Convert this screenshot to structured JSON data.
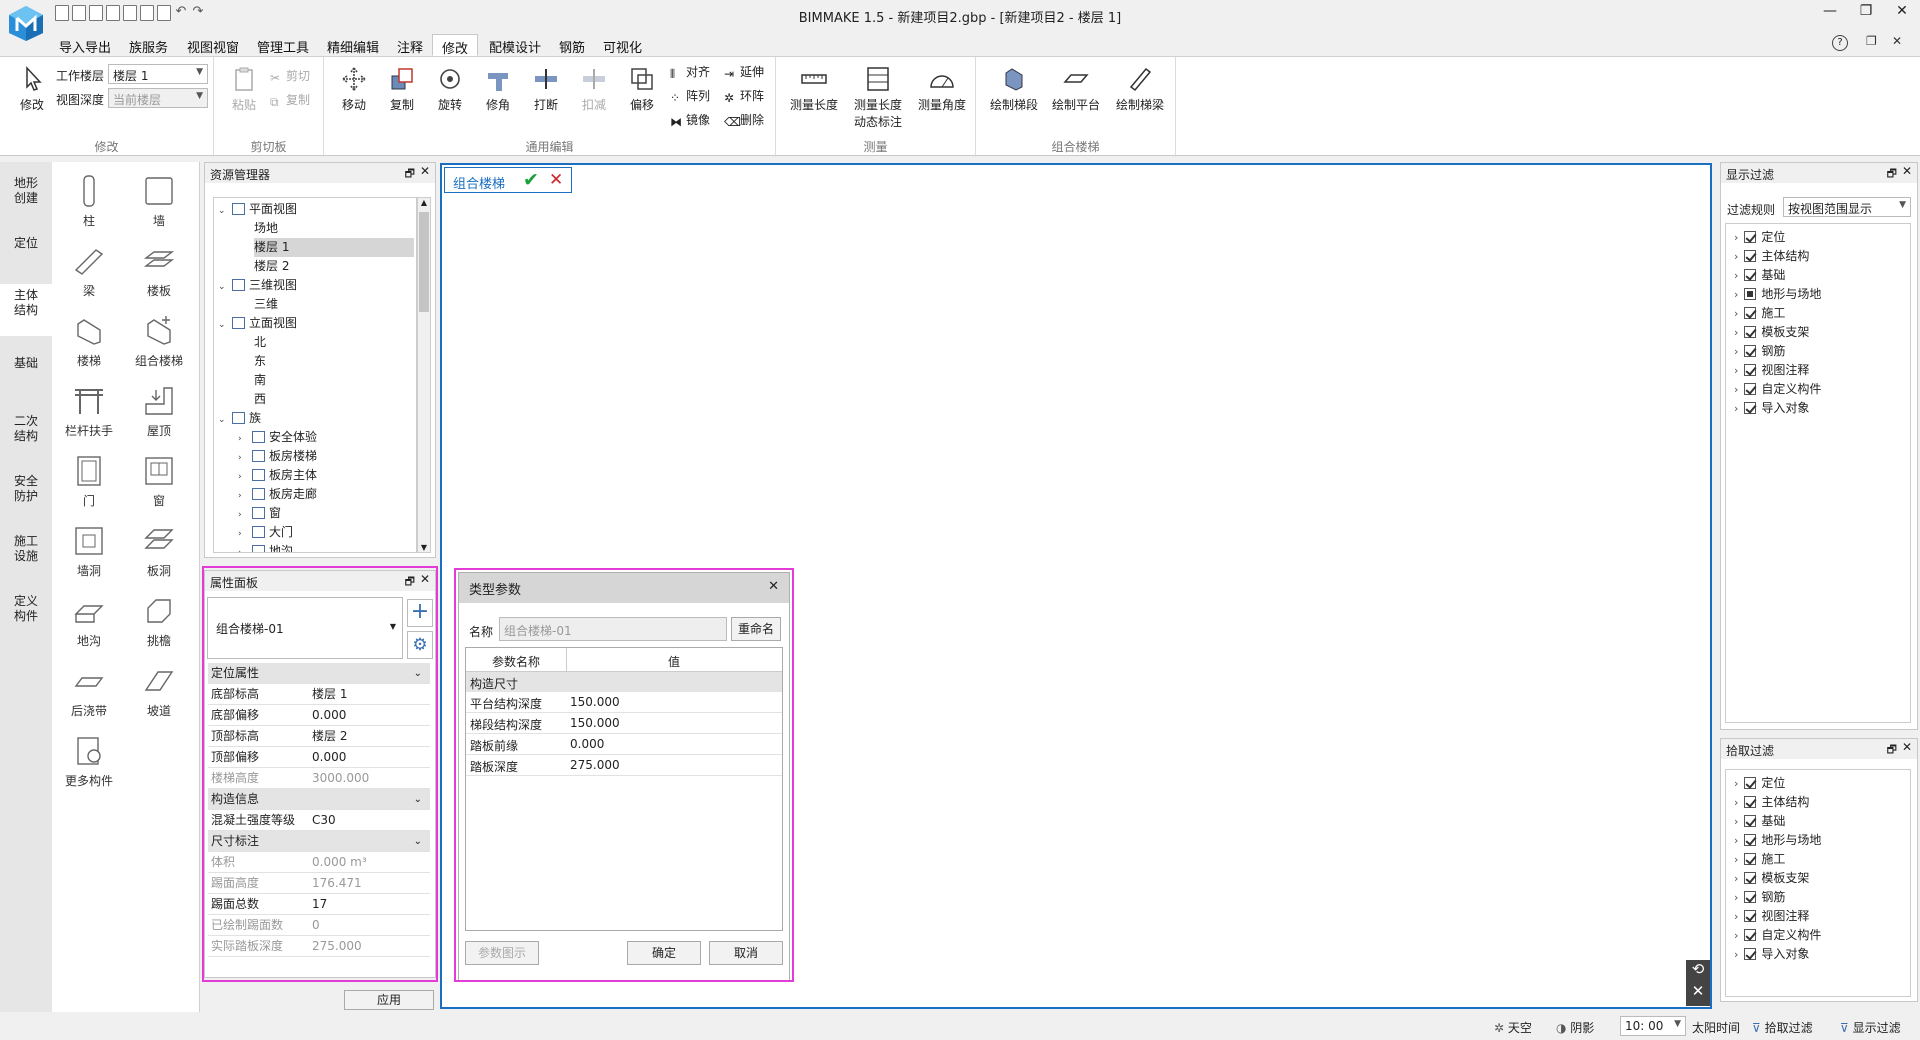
{
  "window": {
    "title": "BIMMAKE 1.5 - 新建项目2.gbp - [新建项目2 - 楼层 1]",
    "minimize": "—",
    "restore": "❐",
    "close": "✕"
  },
  "menu": {
    "tabs": [
      "导入导出",
      "族服务",
      "视图视窗",
      "管理工具",
      "精细编辑",
      "注释",
      "修改",
      "配模设计",
      "钢筋",
      "可视化"
    ],
    "active_index": 6,
    "help": "?",
    "ribbon_restore": "❐",
    "ribbon_close": "✕"
  },
  "ribbon": {
    "modify_group": {
      "label": "修改",
      "modify_btn": "修改",
      "work_floor_label": "工作楼层",
      "work_floor_value": "楼层 1",
      "view_depth_label": "视图深度",
      "view_depth_value": "当前楼层"
    },
    "clipboard_group": {
      "label": "剪切板",
      "paste": "粘贴",
      "cut": "剪切",
      "copy": "复制"
    },
    "edit_group": {
      "label": "通用编辑",
      "move": "移动",
      "copy": "复制",
      "rotate": "旋转",
      "corner": "修角",
      "break": "打断",
      "trim": "扣减",
      "offset": "偏移",
      "align": "对齐",
      "array": "阵列",
      "mirror": "镜像",
      "extend": "延伸",
      "ring_array": "环阵",
      "delete": "删除"
    },
    "measure_group": {
      "label": "测量",
      "length": "测量长度",
      "length_dim_1": "测量长度",
      "length_dim_2": "动态标注",
      "angle": "测量角度"
    },
    "stairs_group": {
      "label": "组合楼梯",
      "draw_flight": "绘制梯段",
      "draw_platform": "绘制平台",
      "draw_beam": "绘制梯梁"
    }
  },
  "categories": [
    "地形\n创建",
    "定位",
    "主体\n结构",
    "基础",
    "二次\n结构",
    "安全\n防护",
    "施工\n设施",
    "定义\n构件"
  ],
  "active_category": 2,
  "palette": [
    "柱",
    "墙",
    "梁",
    "楼板",
    "楼梯",
    "组合楼梯",
    "栏杆扶手",
    "屋顶",
    "门",
    "窗",
    "墙洞",
    "板洞",
    "地沟",
    "挑檐",
    "后浇带",
    "坡道",
    "更多构件"
  ],
  "resource_manager": {
    "title": "资源管理器",
    "pin": "🗗",
    "close": "✕",
    "tree": [
      {
        "label": "平面视图",
        "level": 0,
        "twist": "v",
        "icon": true
      },
      {
        "label": "场地",
        "level": 1
      },
      {
        "label": "楼层 1",
        "level": 1,
        "selected": true
      },
      {
        "label": "楼层 2",
        "level": 1
      },
      {
        "label": "三维视图",
        "level": 0,
        "twist": "v",
        "icon": true
      },
      {
        "label": "三维",
        "level": 1
      },
      {
        "label": "立面视图",
        "level": 0,
        "twist": "v",
        "icon": true
      },
      {
        "label": "北",
        "level": 1
      },
      {
        "label": "东",
        "level": 1
      },
      {
        "label": "南",
        "level": 1
      },
      {
        "label": "西",
        "level": 1
      },
      {
        "label": "族",
        "level": 0,
        "twist": "v",
        "icon": true
      },
      {
        "label": "安全体验",
        "level": 1,
        "twist": ">",
        "icon": true
      },
      {
        "label": "板房楼梯",
        "level": 1,
        "twist": ">",
        "icon": true
      },
      {
        "label": "板房主体",
        "level": 1,
        "twist": ">",
        "icon": true
      },
      {
        "label": "板房走廊",
        "level": 1,
        "twist": ">",
        "icon": true
      },
      {
        "label": "窗",
        "level": 1,
        "twist": ">",
        "icon": true
      },
      {
        "label": "大门",
        "level": 1,
        "twist": ">",
        "icon": true
      },
      {
        "label": "地沟",
        "level": 1,
        "twist": ">",
        "icon": true
      }
    ]
  },
  "properties": {
    "title": "属性面板",
    "pin": "🗗",
    "close": "✕",
    "type_name": "组合楼梯-01",
    "add_icon": "+",
    "settings_icon": "⚙",
    "rows": [
      {
        "key": "定位属性",
        "section": true
      },
      {
        "key": "底部标高",
        "value": "楼层 1"
      },
      {
        "key": "底部偏移",
        "value": "0.000"
      },
      {
        "key": "顶部标高",
        "value": "楼层 2"
      },
      {
        "key": "顶部偏移",
        "value": "0.000"
      },
      {
        "key": "楼梯高度",
        "value": "3000.000",
        "dim": true
      },
      {
        "key": "构造信息",
        "section": true
      },
      {
        "key": "混凝土强度等级",
        "value": "C30"
      },
      {
        "key": "尺寸标注",
        "section": true
      },
      {
        "key": "体积",
        "value": "0.000 m³",
        "dim": true
      },
      {
        "key": "踢面高度",
        "value": "176.471",
        "dim": true
      },
      {
        "key": "踢面总数",
        "value": "17"
      },
      {
        "key": "已绘制踢面数",
        "value": "0",
        "dim": true
      },
      {
        "key": "实际踏板深度",
        "value": "275.000",
        "dim": true
      }
    ],
    "apply": "应用"
  },
  "canvas": {
    "tab_label": "组合楼梯",
    "confirm": "✔",
    "cancel": "✕",
    "reset_icon": "⟲",
    "close_icon": "✕"
  },
  "type_params_dialog": {
    "title": "类型参数",
    "close": "✕",
    "name_label": "名称",
    "name_value": "组合楼梯-01",
    "rename": "重命名",
    "col_param": "参数名称",
    "col_value": "值",
    "section": "构造尺寸",
    "rows": [
      {
        "param": "平台结构深度",
        "value": "150.000"
      },
      {
        "param": "梯段结构深度",
        "value": "150.000"
      },
      {
        "param": "踏板前缘",
        "value": "0.000"
      },
      {
        "param": "踏板深度",
        "value": "275.000"
      }
    ],
    "param_diagram": "参数图示",
    "ok": "确定",
    "cancel": "取消"
  },
  "display_filter": {
    "title": "显示过滤",
    "pin": "🗗",
    "close": "✕",
    "rule_label": "过滤规则",
    "rule_value": "按视图范围显示",
    "items": [
      {
        "label": "定位",
        "state": "on"
      },
      {
        "label": "主体结构",
        "state": "on"
      },
      {
        "label": "基础",
        "state": "on"
      },
      {
        "label": "地形与场地",
        "state": "part"
      },
      {
        "label": "施工",
        "state": "on"
      },
      {
        "label": "模板支架",
        "state": "on"
      },
      {
        "label": "钢筋",
        "state": "on"
      },
      {
        "label": "视图注释",
        "state": "on"
      },
      {
        "label": "自定义构件",
        "state": "on"
      },
      {
        "label": "导入对象",
        "state": "on"
      }
    ]
  },
  "pick_filter": {
    "title": "拾取过滤",
    "pin": "🗗",
    "close": "✕",
    "items": [
      {
        "label": "定位",
        "state": "on"
      },
      {
        "label": "主体结构",
        "state": "on"
      },
      {
        "label": "基础",
        "state": "on"
      },
      {
        "label": "地形与场地",
        "state": "on"
      },
      {
        "label": "施工",
        "state": "on"
      },
      {
        "label": "模板支架",
        "state": "on"
      },
      {
        "label": "钢筋",
        "state": "on"
      },
      {
        "label": "视图注释",
        "state": "on"
      },
      {
        "label": "自定义构件",
        "state": "on"
      },
      {
        "label": "导入对象",
        "state": "on"
      }
    ]
  },
  "statusbar": {
    "sky": "天空",
    "shadow": "阴影",
    "time_value": "10: 00",
    "sun_time": "太阳时间",
    "pick_filter": "拾取过滤",
    "display_filter": "显示过滤"
  },
  "colors": {
    "accent": "#1a6fc1",
    "highlight": "#e33bd6",
    "confirm": "#1aa23a",
    "cancel": "#d2222a"
  }
}
